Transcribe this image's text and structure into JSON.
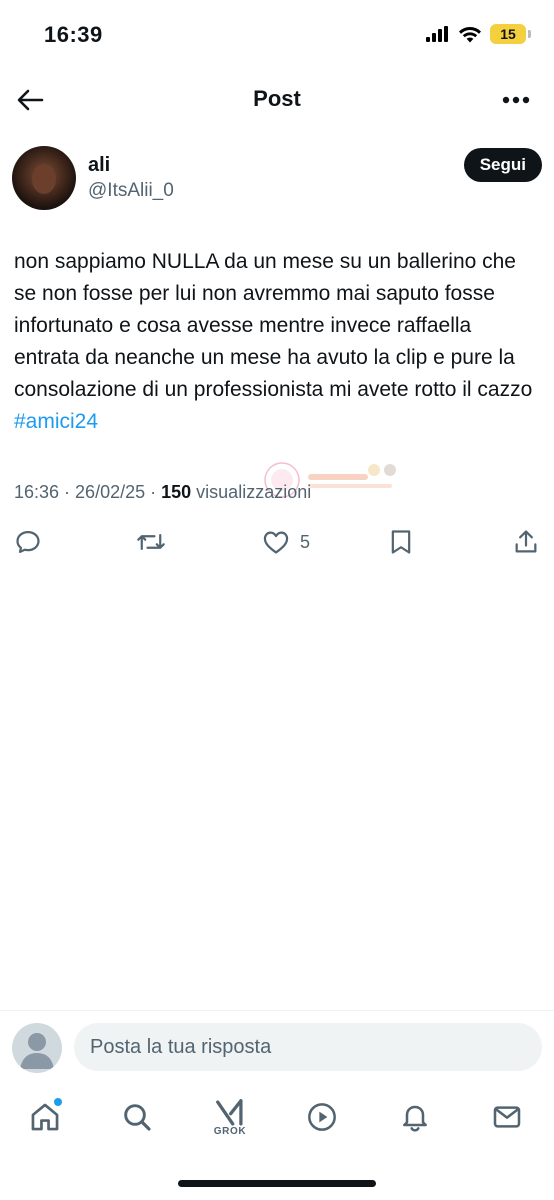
{
  "status_bar": {
    "time": "16:39",
    "battery": "15"
  },
  "header": {
    "title": "Post"
  },
  "author": {
    "name": "ali",
    "handle": "@ItsAlii_0",
    "follow_label": "Segui"
  },
  "tweet": {
    "text": "non sappiamo NULLA da un mese su un ballerino che se non fosse per lui non avremmo mai saputo fosse infortunato e cosa avesse mentre invece raffaella entrata da neanche un mese ha avuto la clip e pure la consolazione di un professionista mi avete rotto il cazzo",
    "hashtag": "#amici24",
    "time": "16:36",
    "date": "26/02/25",
    "views_count": "150",
    "views_label": "visualizzazioni",
    "separator": "·"
  },
  "actions": {
    "likes": "5"
  },
  "reply": {
    "placeholder": "Posta la tua risposta"
  },
  "tabs": {
    "grok_label": "GROK"
  },
  "colors": {
    "accent": "#1d9bf0",
    "text": "#0f1419",
    "muted": "#536471"
  },
  "icons": [
    "back-arrow-icon",
    "more-icon",
    "reply-icon",
    "repost-icon",
    "like-icon",
    "bookmark-icon",
    "share-icon",
    "home-icon",
    "search-icon",
    "grok-icon",
    "video-icon",
    "notifications-icon",
    "messages-icon"
  ]
}
